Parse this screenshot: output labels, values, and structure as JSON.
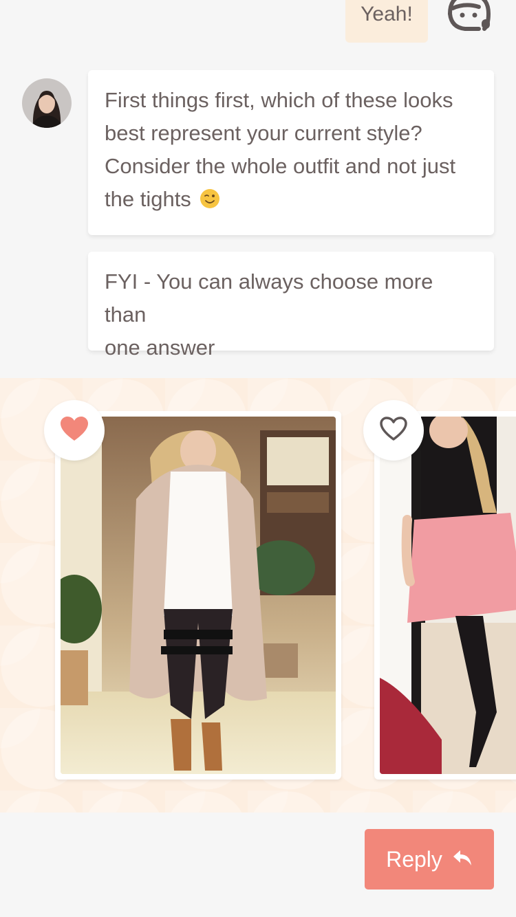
{
  "user_message": {
    "text": "Yeah!"
  },
  "bot_messages": [
    {
      "lines": [
        "First things first, which of these looks",
        "best represent your current style?",
        "Consider the whole outfit and not just",
        "the tights"
      ],
      "emoji": "winking-face-emoji"
    },
    {
      "lines": [
        "FYI - You can always choose more than",
        "one answer"
      ]
    }
  ],
  "cards": [
    {
      "favorited": true,
      "heart_icon": "heart-filled-icon"
    },
    {
      "favorited": false,
      "heart_icon": "heart-outline-icon"
    }
  ],
  "reply_button": {
    "label": "Reply",
    "icon": "reply-arrow-icon"
  },
  "colors": {
    "accent": "#f2877a",
    "user_bubble": "#fbeddc",
    "carousel_bg": "#fdeee0",
    "text": "#6b6160"
  }
}
